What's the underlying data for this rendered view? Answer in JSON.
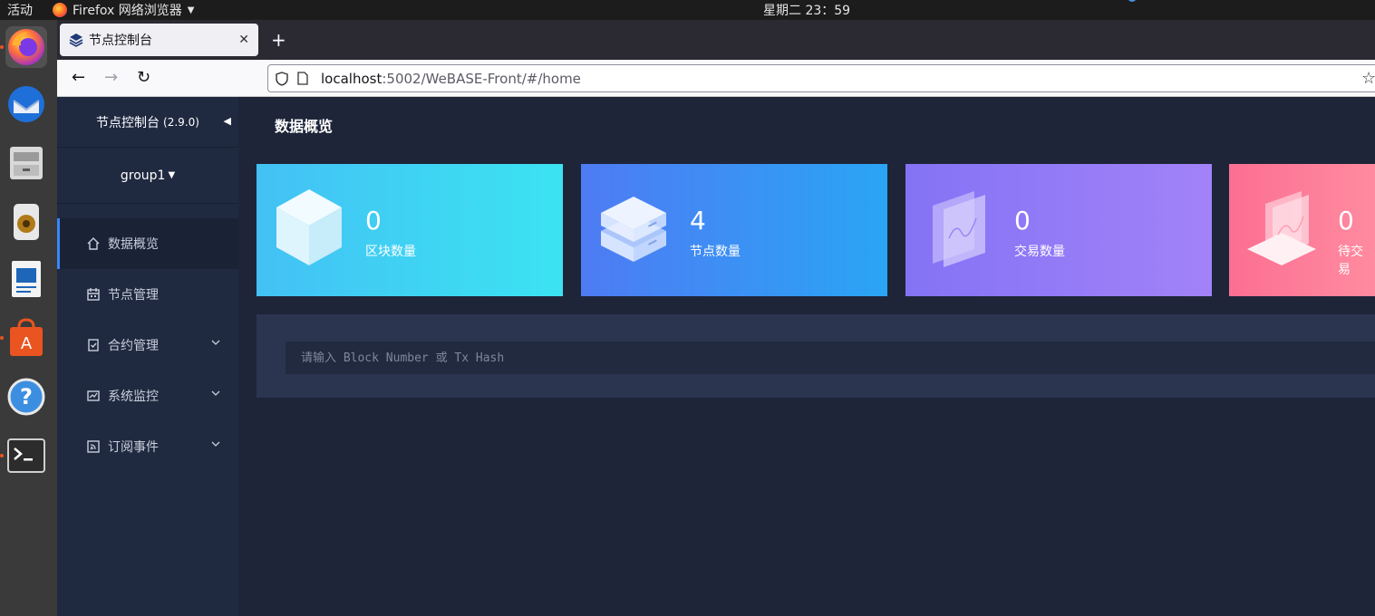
{
  "topbar": {
    "activities": "活动",
    "app_name": "Firefox 网络浏览器",
    "clock": "星期二 23：59"
  },
  "dock": {
    "items": [
      "firefox-icon",
      "thunderbird-icon",
      "files-icon",
      "rhythmbox-icon",
      "writer-icon",
      "software-icon",
      "help-icon",
      "terminal-icon"
    ]
  },
  "browser": {
    "tab_title": "节点控制台",
    "url_host": "localhost",
    "url_path": ":5002/WeBASE-Front/#/home"
  },
  "sidebar": {
    "title": "节点控制台",
    "version": "(2.9.0)",
    "group": "group1",
    "items": [
      {
        "label": "数据概览"
      },
      {
        "label": "节点管理"
      },
      {
        "label": "合约管理"
      },
      {
        "label": "系统监控"
      },
      {
        "label": "订阅事件"
      }
    ]
  },
  "main": {
    "title": "数据概览",
    "cards": [
      {
        "value": "0",
        "label": "区块数量"
      },
      {
        "value": "4",
        "label": "节点数量"
      },
      {
        "value": "0",
        "label": "交易数量"
      },
      {
        "value": "0",
        "label": "待交易"
      }
    ],
    "search_placeholder": "请输入 Block Number 或 Tx Hash"
  },
  "colors": {
    "accent": "#3a86ff",
    "card_cyan": "#3be3f2",
    "card_blue": "#2aa5f5",
    "card_purple": "#a282f8",
    "card_pink": "#ff8ba0"
  }
}
